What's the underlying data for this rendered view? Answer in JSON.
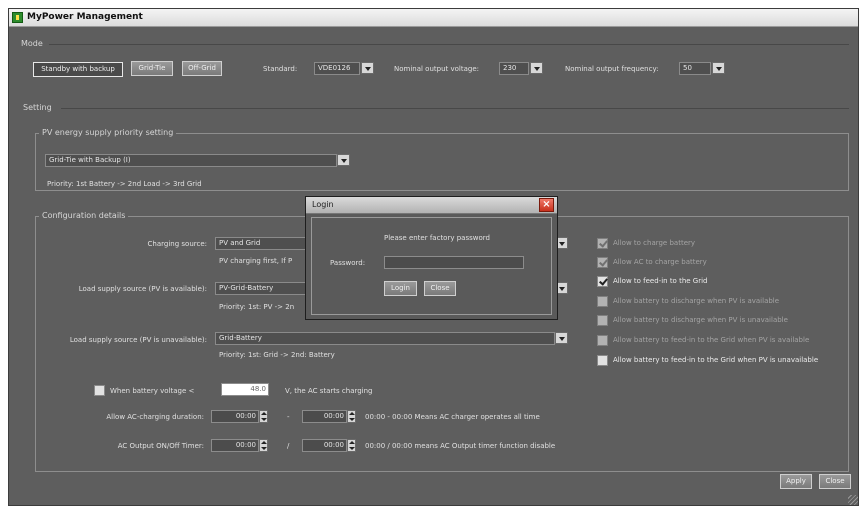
{
  "window": {
    "title": "MyPower Management"
  },
  "mode": {
    "section_label": "Mode",
    "buttons": [
      "Standby with backup",
      "Grid-Tie",
      "Off-Grid"
    ],
    "standard_label": "Standard:",
    "standard_value": "VDE0126",
    "nominal_voltage_label": "Nominal output voltage:",
    "nominal_voltage_value": "230",
    "nominal_freq_label": "Nominal output frequency:",
    "nominal_freq_value": "50"
  },
  "setting": {
    "section_label": "Setting",
    "pv_group_label": "PV energy supply priority setting",
    "pv_priority_value": "Grid-Tie with Backup (I)",
    "priority_text": "Priority: 1st Battery -> 2nd Load -> 3rd Grid"
  },
  "config": {
    "group_label": "Configuration details",
    "charging_source_label": "Charging source:",
    "charging_source_value": "PV and Grid",
    "charging_source_note": "PV charging first, If P",
    "load_pv_available_label": "Load supply source (PV is available):",
    "load_pv_available_value": "PV-Grid-Battery",
    "load_pv_available_note": "Priority: 1st: PV -> 2n",
    "load_pv_unavailable_label": "Load supply source (PV is unavailable):",
    "load_pv_unavailable_value": "Grid-Battery",
    "load_pv_unavailable_note": "Priority: 1st: Grid -> 2nd: Battery",
    "battery_voltage_label": "When battery voltage <",
    "battery_voltage_value": "48.0",
    "battery_voltage_suffix": "V, the AC starts charging",
    "ac_duration_label": "Allow AC-charging duration:",
    "ac_duration_from": "00:00",
    "ac_duration_to": "00:00",
    "ac_duration_note": "00:00 - 00:00 Means AC charger operates all time",
    "ac_output_label": "AC Output ON/Off Timer:",
    "ac_output_from": "00:00",
    "ac_output_to": "00:00",
    "ac_output_note": "00:00 / 00:00 means AC Output timer function disable",
    "dash": "-",
    "slash": "/"
  },
  "options": [
    {
      "label": "Allow to charge battery",
      "checked": true,
      "enabled": false
    },
    {
      "label": "Allow AC to charge battery",
      "checked": true,
      "enabled": false
    },
    {
      "label": "Allow to feed-in to the Grid",
      "checked": true,
      "enabled": true
    },
    {
      "label": "Allow battery to discharge when PV is available",
      "checked": false,
      "enabled": false
    },
    {
      "label": "Allow battery to discharge when PV is unavailable",
      "checked": false,
      "enabled": false
    },
    {
      "label": "Allow battery to feed-in to the Grid when PV is available",
      "checked": false,
      "enabled": false
    },
    {
      "label": "Allow battery to feed-in to the Grid when PV is unavailable",
      "checked": false,
      "enabled": true
    }
  ],
  "footer": {
    "apply": "Apply",
    "close": "Close"
  },
  "dialog": {
    "title": "Login",
    "close_glyph": "×",
    "prompt": "Please enter factory password",
    "password_label": "Password:",
    "login": "Login",
    "cancel": "Close"
  }
}
